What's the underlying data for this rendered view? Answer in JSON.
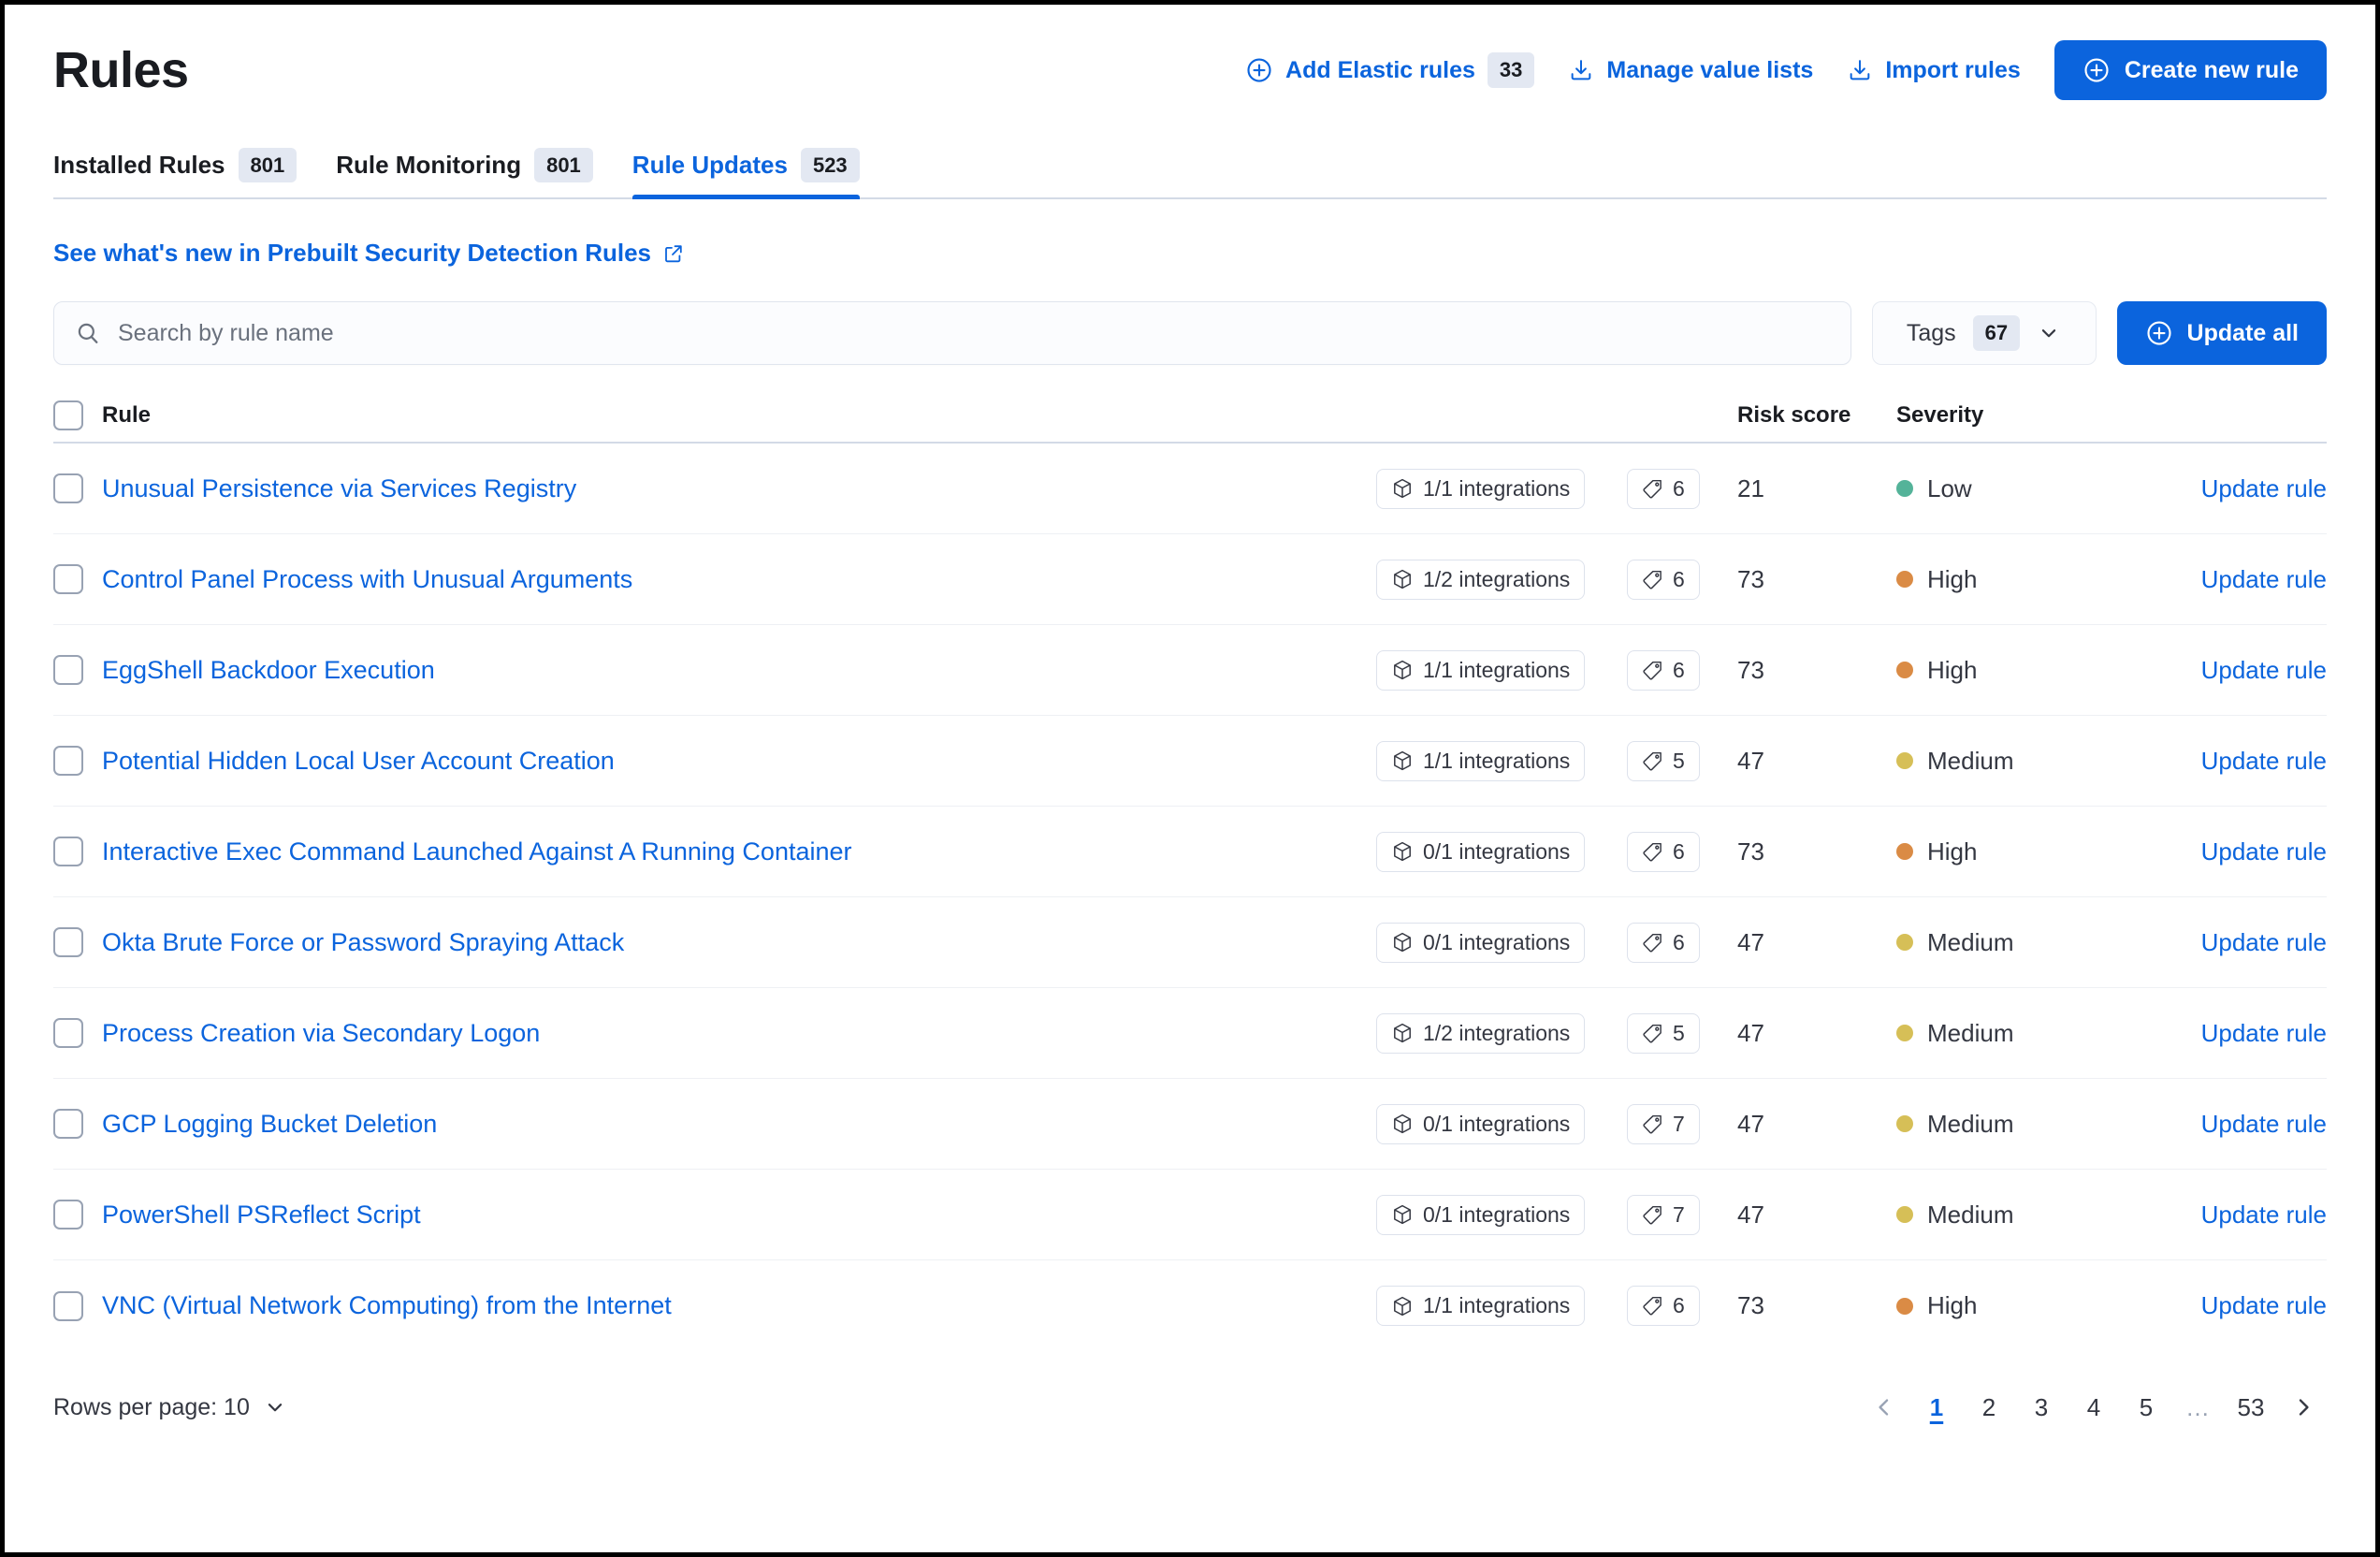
{
  "header": {
    "title": "Rules",
    "actions": [
      {
        "icon": "plus-in-circle-icon",
        "label": "Add Elastic rules",
        "count": "33"
      },
      {
        "icon": "import-icon",
        "label": "Manage value lists",
        "count": null
      },
      {
        "icon": "import-icon",
        "label": "Import rules",
        "count": null
      }
    ],
    "primary_button": {
      "icon": "plus-in-circle-icon",
      "label": "Create new rule"
    }
  },
  "tabs": [
    {
      "label": "Installed Rules",
      "count": "801",
      "active": false
    },
    {
      "label": "Rule Monitoring",
      "count": "801",
      "active": false
    },
    {
      "label": "Rule Updates",
      "count": "523",
      "active": true
    }
  ],
  "whats_new": {
    "label": "See what's new in Prebuilt Security Detection Rules",
    "icon": "external-link-icon"
  },
  "search": {
    "icon": "search-icon",
    "placeholder": "Search by rule name",
    "value": ""
  },
  "filters": {
    "tags": {
      "label": "Tags",
      "count": "67",
      "icon": "chevron-down-icon"
    },
    "update_all": {
      "icon": "plus-in-circle-icon",
      "label": "Update all"
    }
  },
  "table": {
    "columns": {
      "rule": "Rule",
      "risk_score": "Risk score",
      "severity": "Severity"
    },
    "action_label": "Update rule",
    "integrations_suffix": "integrations",
    "icons": {
      "integration": "package-icon",
      "tag": "tag-icon",
      "checkbox": "checkbox-icon"
    },
    "rows": [
      {
        "name": "Unusual Persistence via Services Registry",
        "integrations": "1/1 integrations",
        "tags": "6",
        "risk_score": "21",
        "severity": "Low",
        "severity_color": "#54b399",
        "action": "Update rule"
      },
      {
        "name": "Control Panel Process with Unusual Arguments",
        "integrations": "1/2 integrations",
        "tags": "6",
        "risk_score": "73",
        "severity": "High",
        "severity_color": "#da8b45",
        "action": "Update rule"
      },
      {
        "name": "EggShell Backdoor Execution",
        "integrations": "1/1 integrations",
        "tags": "6",
        "risk_score": "73",
        "severity": "High",
        "severity_color": "#da8b45",
        "action": "Update rule"
      },
      {
        "name": "Potential Hidden Local User Account Creation",
        "integrations": "1/1 integrations",
        "tags": "5",
        "risk_score": "47",
        "severity": "Medium",
        "severity_color": "#d6bf57",
        "action": "Update rule"
      },
      {
        "name": "Interactive Exec Command Launched Against A Running Container",
        "integrations": "0/1 integrations",
        "tags": "6",
        "risk_score": "73",
        "severity": "High",
        "severity_color": "#da8b45",
        "action": "Update rule"
      },
      {
        "name": "Okta Brute Force or Password Spraying Attack",
        "integrations": "0/1 integrations",
        "tags": "6",
        "risk_score": "47",
        "severity": "Medium",
        "severity_color": "#d6bf57",
        "action": "Update rule"
      },
      {
        "name": "Process Creation via Secondary Logon",
        "integrations": "1/2 integrations",
        "tags": "5",
        "risk_score": "47",
        "severity": "Medium",
        "severity_color": "#d6bf57",
        "action": "Update rule"
      },
      {
        "name": "GCP Logging Bucket Deletion",
        "integrations": "0/1 integrations",
        "tags": "7",
        "risk_score": "47",
        "severity": "Medium",
        "severity_color": "#d6bf57",
        "action": "Update rule"
      },
      {
        "name": "PowerShell PSReflect Script",
        "integrations": "0/1 integrations",
        "tags": "7",
        "risk_score": "47",
        "severity": "Medium",
        "severity_color": "#d6bf57",
        "action": "Update rule"
      },
      {
        "name": "VNC (Virtual Network Computing) from the Internet",
        "integrations": "1/1 integrations",
        "tags": "6",
        "risk_score": "73",
        "severity": "High",
        "severity_color": "#da8b45",
        "action": "Update rule"
      }
    ]
  },
  "footer": {
    "rows_per_page_label": "Rows per page: 10",
    "rows_per_page_icon": "chevron-down-icon",
    "pagination": {
      "prev_icon": "chevron-left-icon",
      "next_icon": "chevron-right-icon",
      "pages": [
        "1",
        "2",
        "3",
        "4",
        "5",
        "…",
        "53"
      ],
      "current": "1"
    }
  },
  "colors": {
    "accent": "#0b64dd",
    "text": "#343741",
    "heading": "#1a1c21",
    "border": "#d3dae6",
    "severity_low": "#54b399",
    "severity_medium": "#d6bf57",
    "severity_high": "#da8b45"
  }
}
